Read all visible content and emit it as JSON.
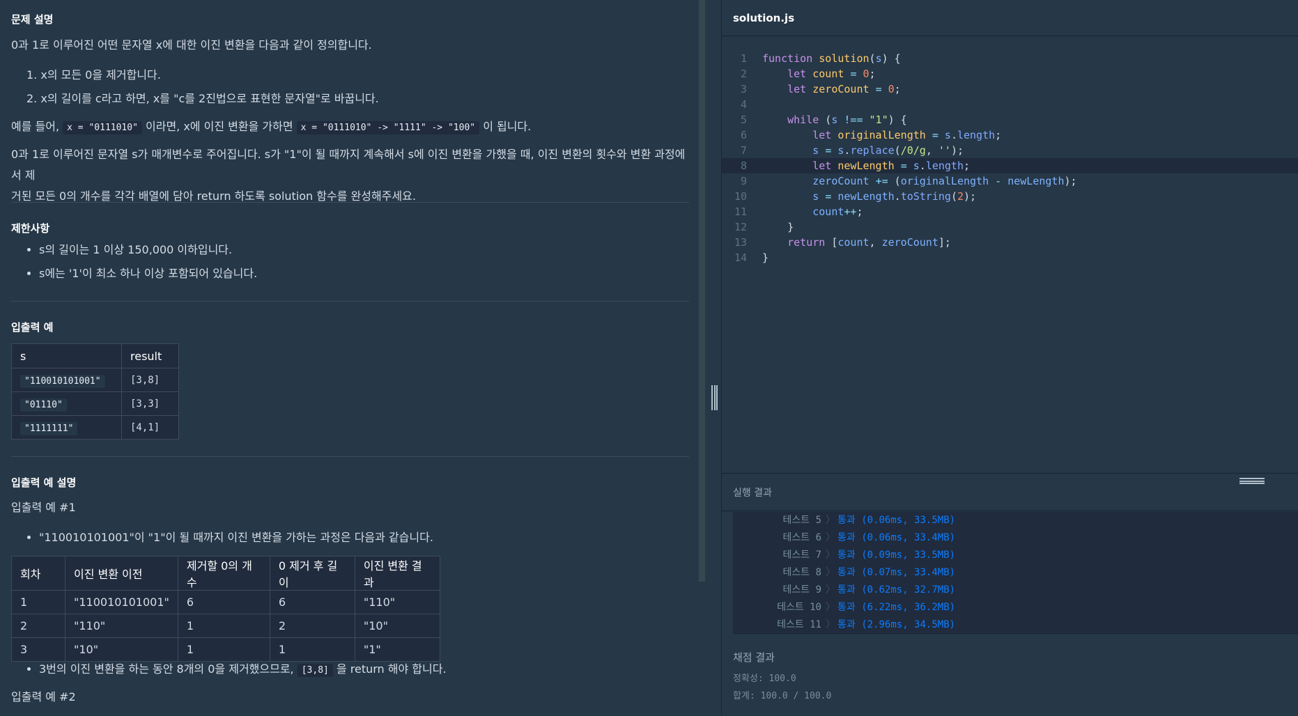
{
  "problem": {
    "section_title": "문제 설명",
    "intro": "0과 1로 이루어진 어떤 문자열 x에 대한 이진 변환을 다음과 같이 정의합니다.",
    "steps": [
      "1. x의 모든 0을 제거합니다.",
      "2. x의 길이를 c라고 하면, x를 \"c를 2진법으로 표현한 문자열\"로 바꿉니다."
    ],
    "example_prefix": "예를 들어,",
    "example_code1": "x = \"0111010\"",
    "example_mid": "이라면, x에 이진 변환을 가하면",
    "example_code2": "x = \"0111010\" -> \"1111\" -> \"100\"",
    "example_suffix": "이 됩니다.",
    "description_line1": "0과 1로 이루어진 문자열 s가 매개변수로 주어집니다. s가 \"1\"이 될 때까지 계속해서 s에 이진 변환을 가했을 때, 이진 변환의 횟수와 변환 과정에서 제",
    "description_line2": "거된 모든 0의 개수를 각각 배열에 담아 return 하도록 solution 함수를 완성해주세요."
  },
  "constraints": {
    "title": "제한사항",
    "items": [
      "s의 길이는 1 이상 150,000 이하입니다.",
      "s에는 '1'이 최소 하나 이상 포함되어 있습니다."
    ]
  },
  "examples": {
    "title": "입출력 예",
    "headers": [
      "s",
      "result"
    ],
    "rows": [
      [
        "\"110010101001\"",
        "[3,8]"
      ],
      [
        "\"01110\"",
        "[3,3]"
      ],
      [
        "\"1111111\"",
        "[4,1]"
      ]
    ]
  },
  "explanation": {
    "title": "입출력 예 설명",
    "example1_title": "입출력 예 #1",
    "bullet1": "\"110010101001\"이 \"1\"이 될 때까지 이진 변환을 가하는 과정은 다음과 같습니다.",
    "headers": [
      "회차",
      "이진 변환 이전",
      "제거할 0의 개수",
      "0 제거 후 길이",
      "이진 변환 결과"
    ],
    "rows": [
      [
        "1",
        "\"110010101001\"",
        "6",
        "6",
        "\"110\""
      ],
      [
        "2",
        "\"110\"",
        "1",
        "2",
        "\"10\""
      ],
      [
        "3",
        "\"10\"",
        "1",
        "1",
        "\"1\""
      ]
    ],
    "bullet2_prefix": "3번의 이진 변환을 하는 동안 8개의 0을 제거했으므로,",
    "bullet2_code": "[3,8]",
    "bullet2_suffix": "을 return 해야 합니다.",
    "example2_title": "입출력 예 #2"
  },
  "editor": {
    "filename": "solution.js",
    "line_numbers": [
      "1",
      "2",
      "3",
      "4",
      "5",
      "6",
      "7",
      "8",
      "9",
      "10",
      "11",
      "12",
      "13",
      "14"
    ]
  },
  "result": {
    "title": "실행 결과",
    "tests": [
      {
        "label": "테스트 5",
        "sep": "〉",
        "value": "통과 (0.06ms, 33.5MB)"
      },
      {
        "label": "테스트 6",
        "sep": "〉",
        "value": "통과 (0.06ms, 33.4MB)"
      },
      {
        "label": "테스트 7",
        "sep": "〉",
        "value": "통과 (0.09ms, 33.5MB)"
      },
      {
        "label": "테스트 8",
        "sep": "〉",
        "value": "통과 (0.07ms, 33.4MB)"
      },
      {
        "label": "테스트 9",
        "sep": "〉",
        "value": "통과 (0.62ms, 32.7MB)"
      },
      {
        "label": "테스트 10",
        "sep": "〉",
        "value": "통과 (6.22ms, 36.2MB)"
      },
      {
        "label": "테스트 11",
        "sep": "〉",
        "value": "통과 (2.96ms, 34.5MB)"
      }
    ],
    "grading_title": "채점 결과",
    "accuracy": "정확성: 100.0",
    "total": "합계: 100.0 / 100.0"
  }
}
